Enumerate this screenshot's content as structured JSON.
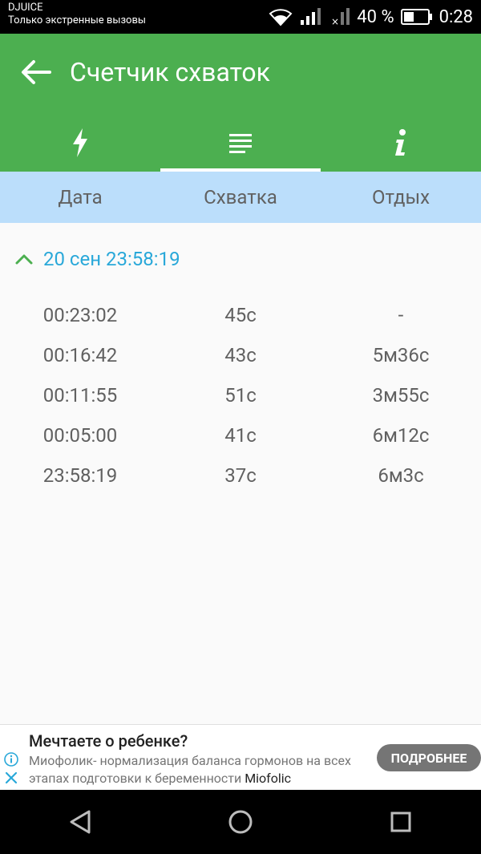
{
  "status_bar": {
    "carrier": "DJUICE",
    "carrier_note": "Только экстренные вызовы",
    "battery": "40 %",
    "time": "0:28"
  },
  "appbar": {
    "title": "Счетчик схваток"
  },
  "tabs": [
    {
      "icon": "lightning-icon",
      "active": false
    },
    {
      "icon": "list-icon",
      "active": true
    },
    {
      "icon": "info-icon",
      "active": false
    }
  ],
  "columns": [
    "Дата",
    "Схватка",
    "Отдых"
  ],
  "group": {
    "title": "20 сен 23:58:19"
  },
  "rows": [
    {
      "time": "00:23:02",
      "contraction": "45с",
      "rest": "-"
    },
    {
      "time": "00:16:42",
      "contraction": "43с",
      "rest": "5м36с"
    },
    {
      "time": "00:11:55",
      "contraction": "51с",
      "rest": "3м55с"
    },
    {
      "time": "00:05:00",
      "contraction": "41с",
      "rest": "6м12с"
    },
    {
      "time": "23:58:19",
      "contraction": "37с",
      "rest": "6м3с"
    }
  ],
  "ad": {
    "title": "Мечтаете о ребенке?",
    "description": "Миофолик- нормализация баланса гормонов на всех этапах подготовки к беременности",
    "brand": "Miofolic",
    "button": "ПОДРОБНЕЕ"
  },
  "colors": {
    "appbar": "#4caf50",
    "header": "#bbdefb",
    "accent": "#29a8d9",
    "chevron": "#4caf50"
  }
}
